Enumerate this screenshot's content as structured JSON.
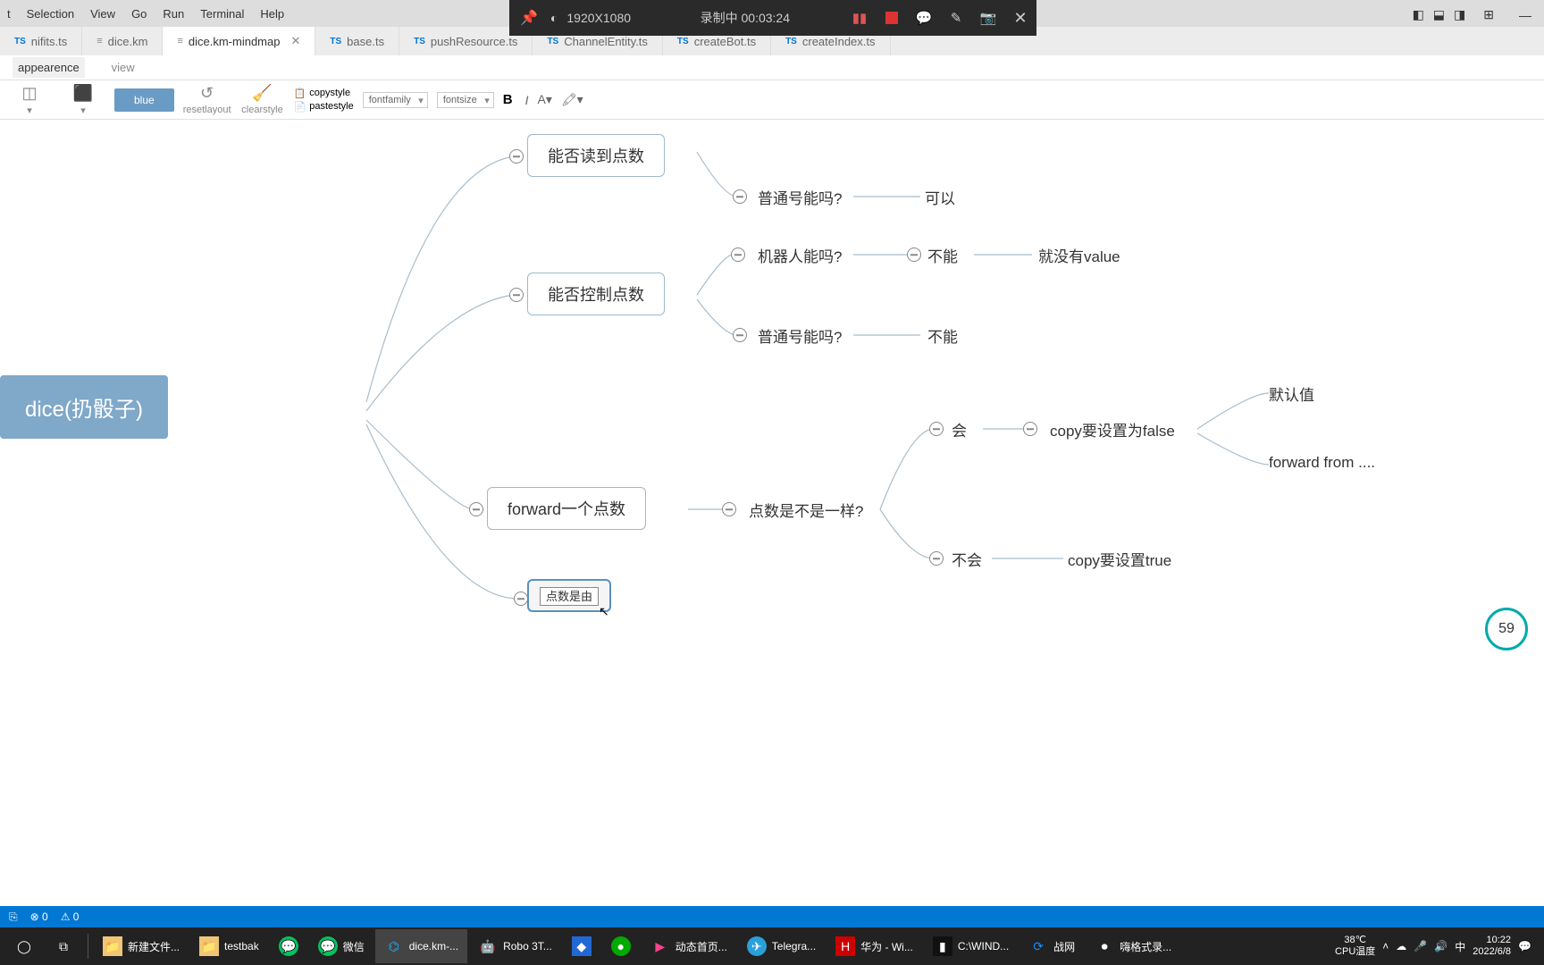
{
  "menu": {
    "items": [
      "t",
      "Selection",
      "View",
      "Go",
      "Run",
      "Terminal",
      "Help"
    ]
  },
  "rec": {
    "dim": "1920X1080",
    "status": "录制中 00:03:24"
  },
  "tabs": [
    {
      "label": "nifits.ts",
      "type": "ts"
    },
    {
      "label": "dice.km",
      "type": "km"
    },
    {
      "label": "dice.km-mindmap",
      "type": "km",
      "active": true,
      "close": true
    },
    {
      "label": "base.ts",
      "type": "ts"
    },
    {
      "label": "pushResource.ts",
      "type": "ts"
    },
    {
      "label": "ChannelEntity.ts",
      "type": "ts"
    },
    {
      "label": "createBot.ts",
      "type": "ts"
    },
    {
      "label": "createIndex.ts",
      "type": "ts"
    }
  ],
  "subtabs": {
    "a": "appearence",
    "b": "view"
  },
  "toolbar": {
    "blue": "blue",
    "reset": "resetlayout",
    "clear": "clearstyle",
    "copy": "copystyle",
    "paste": "pastestyle",
    "ff": "fontfamily",
    "fs": "fontsize",
    "bold": "B",
    "italic": "I",
    "color": "A"
  },
  "nodes": {
    "root": "dice(扔骰子)",
    "n1": "能否读到点数",
    "n2": "能否控制点数",
    "n3": "forward一个点数",
    "n4": "点数是由",
    "q1": "普通号能吗?",
    "a1": "可以",
    "q2": "机器人能吗?",
    "a2": "不能",
    "a2b": "就没有value",
    "q3": "普通号能吗?",
    "a3": "不能",
    "q4": "点数是不是一样?",
    "b1": "会",
    "b1a": "copy要设置为false",
    "b1b": "默认值",
    "b1c": "forward from ....",
    "b2": "不会",
    "b2a": "copy要设置true"
  },
  "status": {
    "err": "0",
    "warn": "0"
  },
  "tasks": [
    {
      "label": "",
      "icon": "⊞"
    },
    {
      "label": "",
      "icon": "⧉"
    },
    {
      "label": "新建文件...",
      "color": "#f0c674"
    },
    {
      "label": "testbak",
      "color": "#f0c674"
    },
    {
      "label": "",
      "color": "#07c160",
      "round": true
    },
    {
      "label": "微信",
      "color": "#07c160",
      "round": true
    },
    {
      "label": "dice.km-...",
      "color": "#24acf2",
      "active": true
    },
    {
      "label": "Robo 3T...",
      "color": "#4fb04f"
    },
    {
      "label": "",
      "color": "#2268d4"
    },
    {
      "label": "",
      "color": "#0a0",
      "round": true
    },
    {
      "label": "动态首页...",
      "color": "#ff4488"
    },
    {
      "label": "Telegra...",
      "color": "#2aa0da"
    },
    {
      "label": "华为 - Wi...",
      "color": "#cc0000"
    },
    {
      "label": "C:\\WIND...",
      "color": "#222"
    },
    {
      "label": "战网",
      "color": "#148eff"
    },
    {
      "label": "嗨格式录...",
      "color": "#555"
    }
  ],
  "tray": {
    "temp": "38℃",
    "templ": "CPU温度",
    "time": "10:22",
    "date": "2022/6/8"
  },
  "badge": "59"
}
